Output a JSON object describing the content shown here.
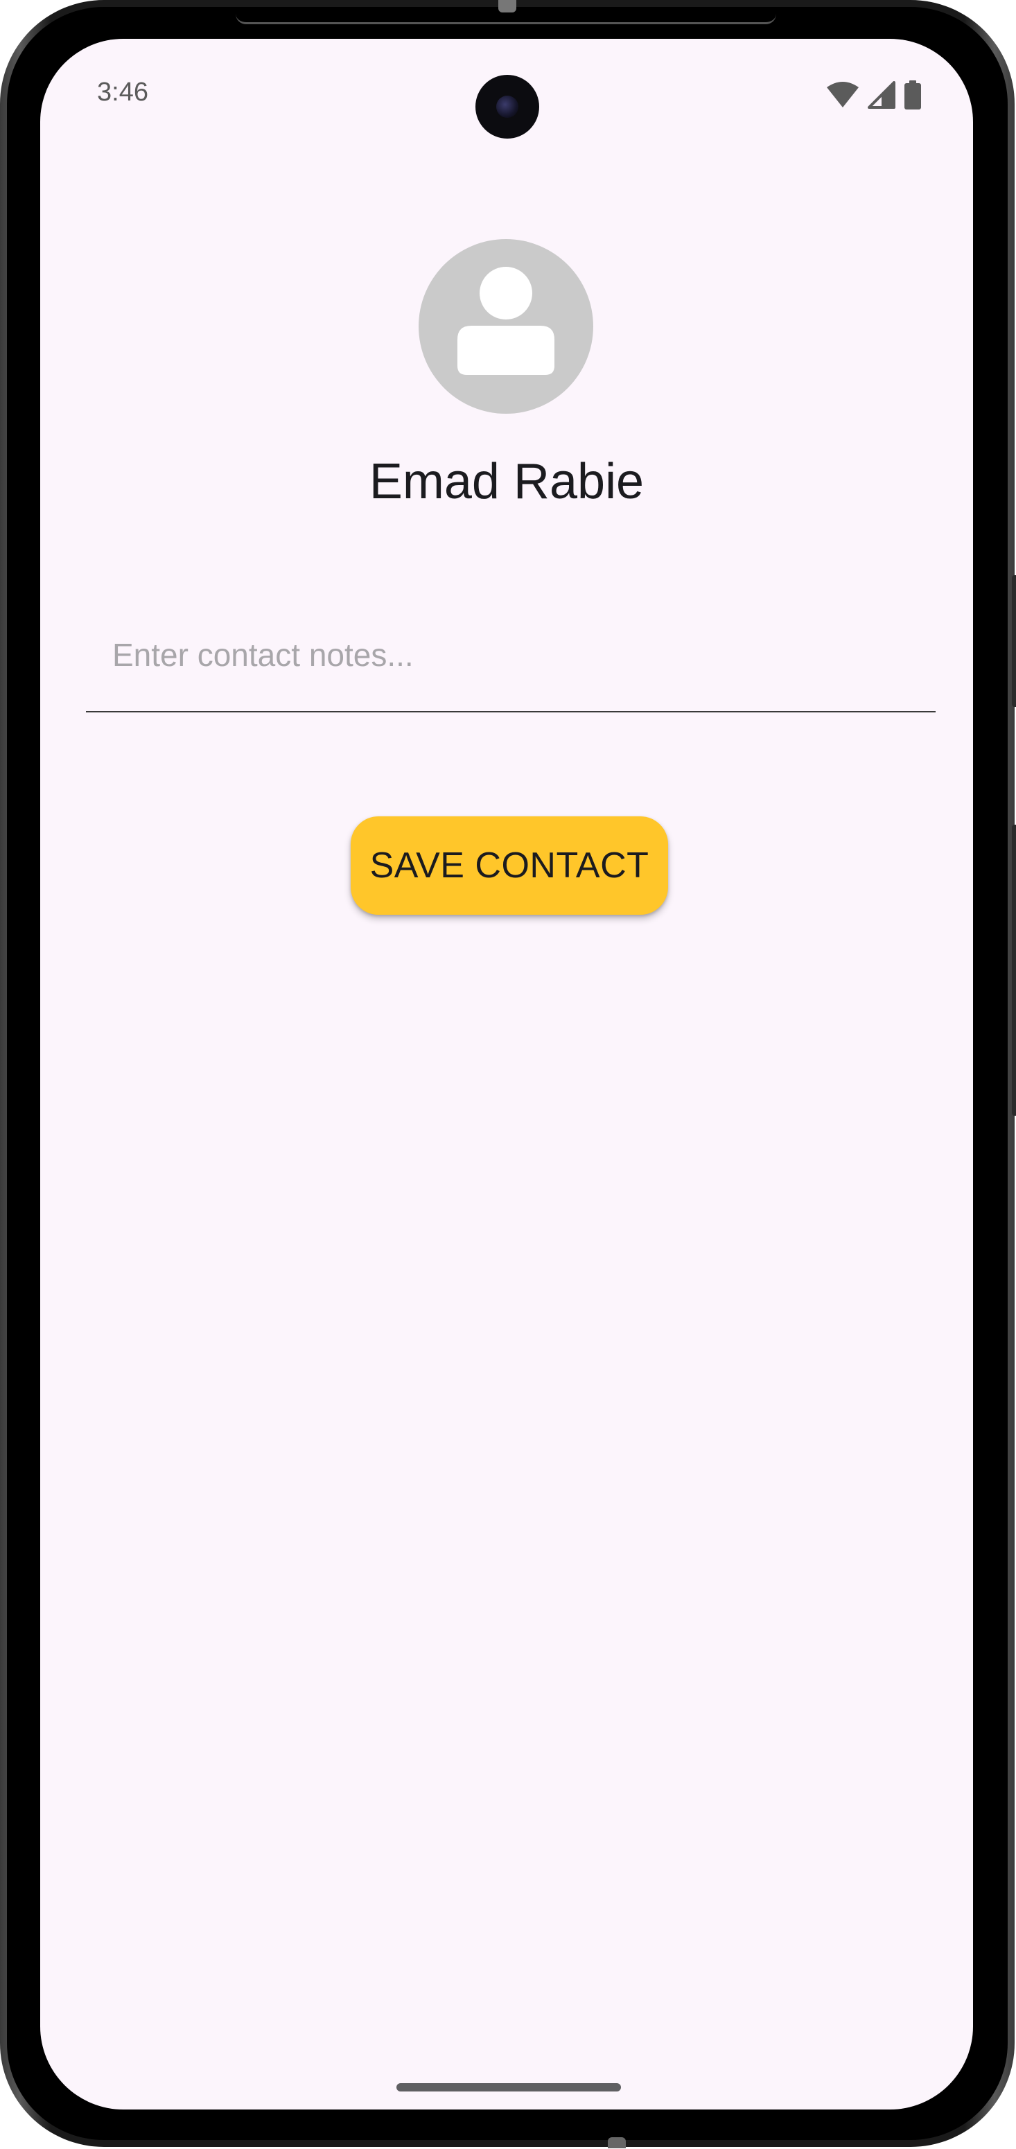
{
  "status_bar": {
    "time": "3:46",
    "icons": [
      "wifi-icon",
      "signal-icon",
      "battery-icon"
    ]
  },
  "contact": {
    "avatar_icon": "person-icon",
    "name": "Emad Rabie"
  },
  "notes": {
    "value": "",
    "placeholder": "Enter contact notes..."
  },
  "actions": {
    "save_label": "SAVE CONTACT"
  },
  "colors": {
    "background": "#fcf5fc",
    "accent": "#ffc62a",
    "avatar_bg": "#cacaca"
  }
}
